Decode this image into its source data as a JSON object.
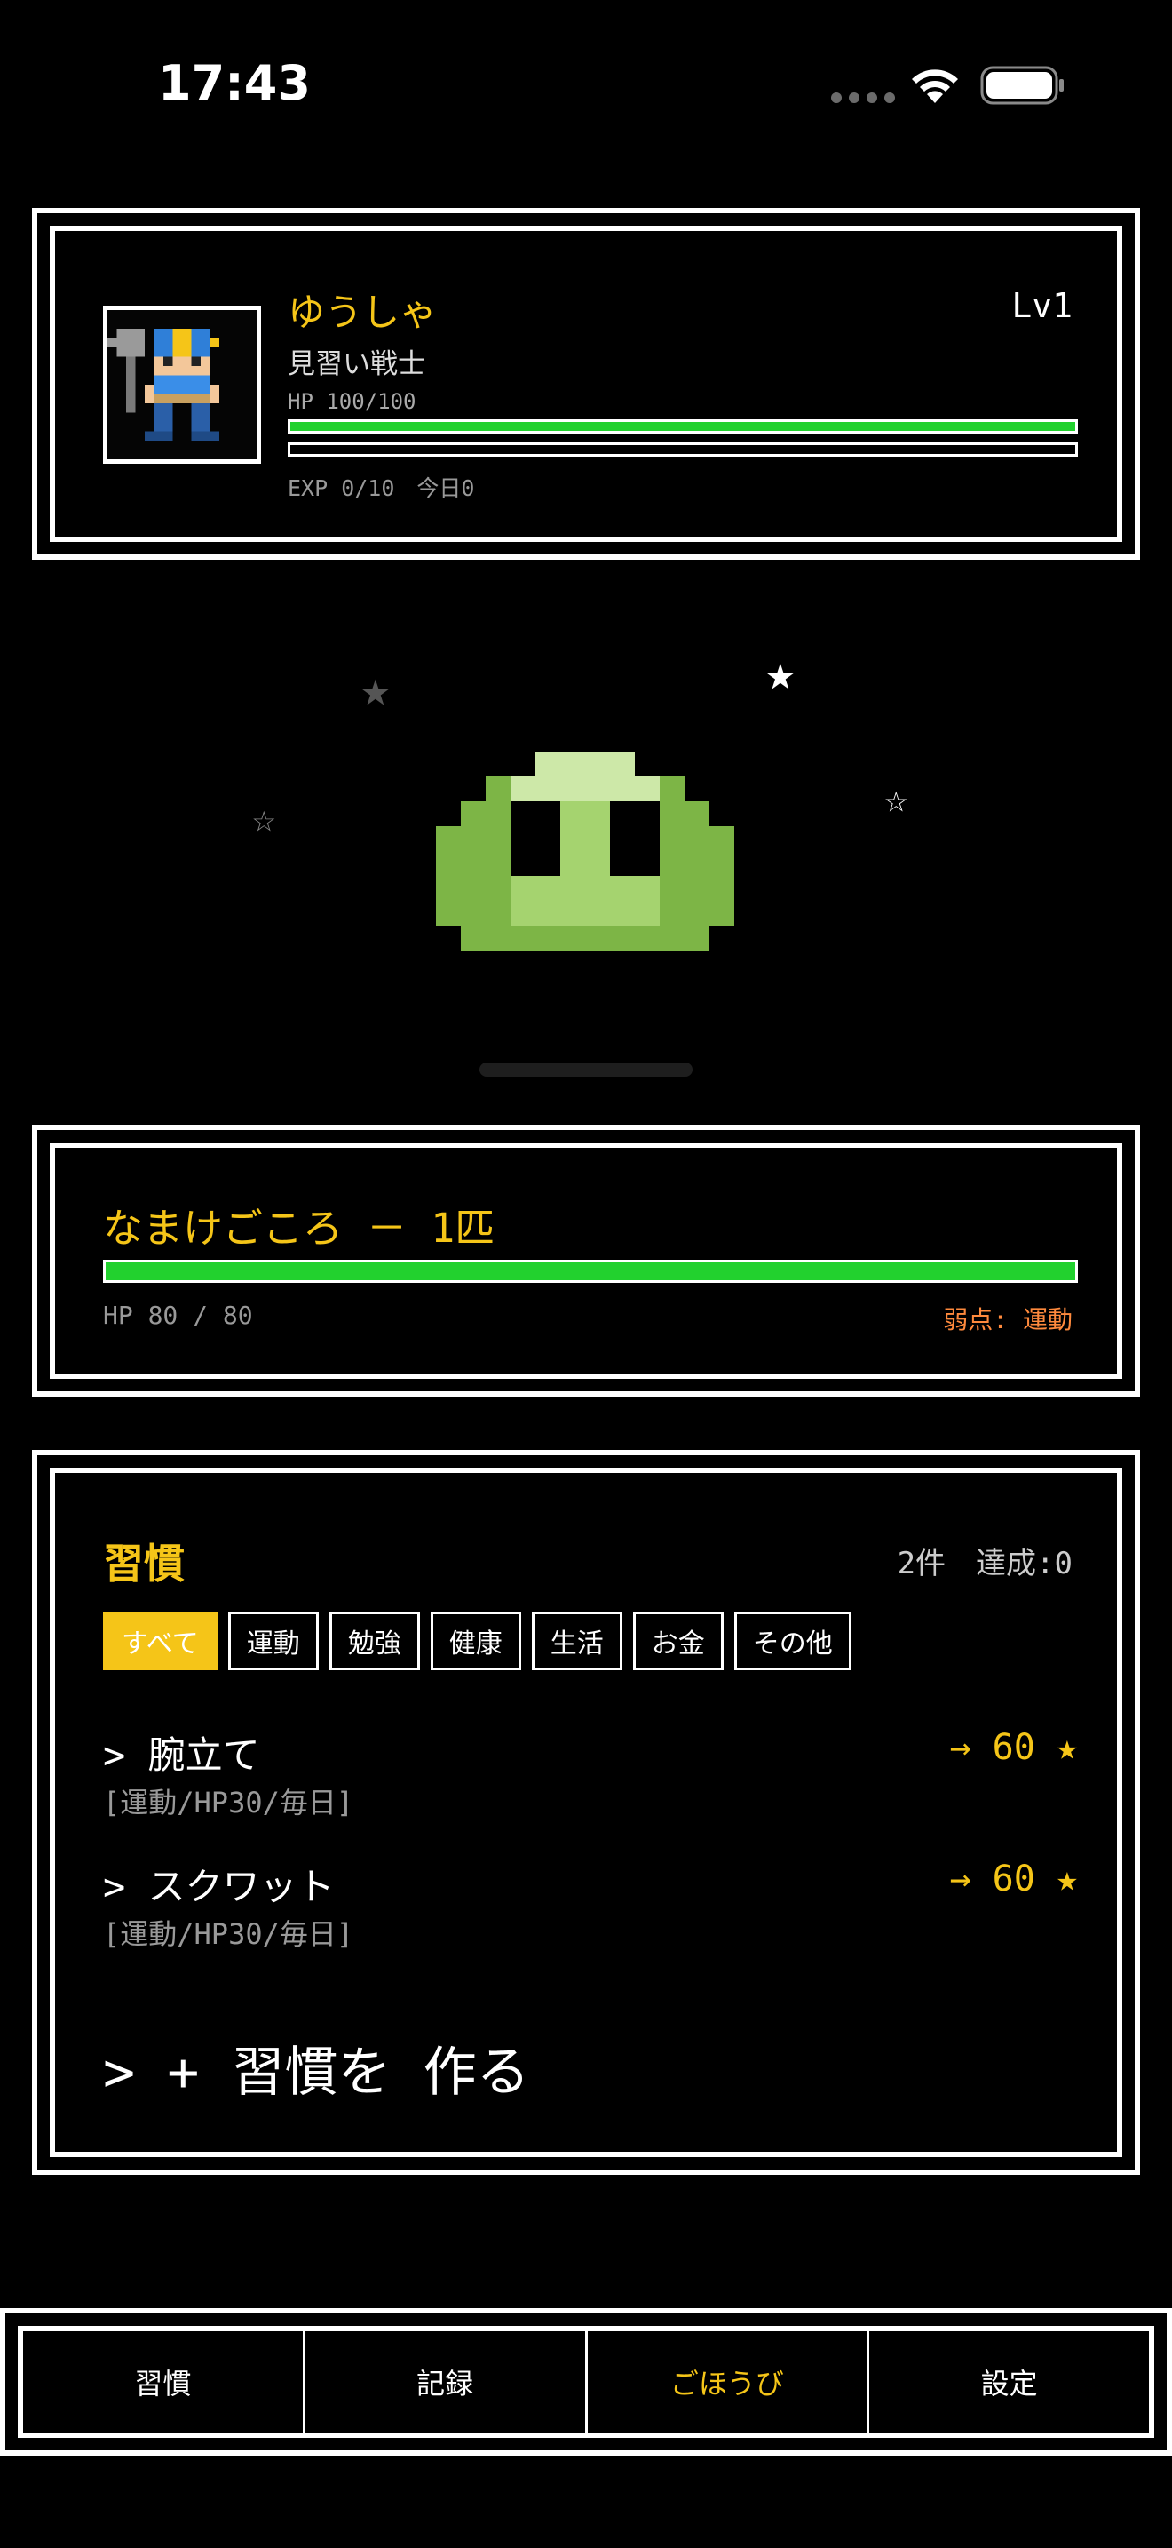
{
  "status_bar": {
    "time": "17:43"
  },
  "hero": {
    "name": "ゆうしゃ",
    "level": "Lv1",
    "class": "見習い戦士",
    "hp_label": "HP 100/100",
    "hp_fraction": 1.0,
    "exp_fraction": 0.0,
    "exp_text": "EXP 0/10　今日0"
  },
  "enemy": {
    "name": "なまけごころ － 1匹",
    "hp_text": "HP 80 / 80",
    "hp_fraction": 1.0,
    "weakness": "弱点: 運動"
  },
  "habits": {
    "title": "習慣",
    "meta": "2件　達成:0",
    "filters": [
      "すべて",
      "運動",
      "勉強",
      "健康",
      "生活",
      "お金",
      "その他"
    ],
    "active_filter": "すべて",
    "items": [
      {
        "name": "> 腕立て",
        "tags": "[運動/HP30/毎日]",
        "reward": "→ 60 ★"
      },
      {
        "name": "> スクワット",
        "tags": "[運動/HP30/毎日]",
        "reward": "→ 60 ★"
      }
    ],
    "create_label": "> + 習慣を 作る"
  },
  "nav": {
    "items": [
      "習慣",
      "記録",
      "ごほうび",
      "設定"
    ],
    "active": "ごほうび"
  },
  "colors": {
    "accent": "#f5c518",
    "hp_green": "#22d12e",
    "weakness_orange": "#ff8a3d",
    "slime_light": "#cde8a8",
    "slime_mid": "#a5d36f",
    "slime_dark": "#7db546"
  }
}
